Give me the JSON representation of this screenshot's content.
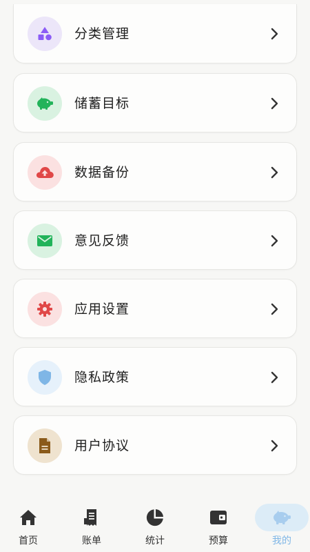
{
  "menu": [
    {
      "label": "分类管理",
      "icon": "shapes-icon",
      "bg": "#ece6f9",
      "fg": "#8b5cf6"
    },
    {
      "label": "储蓄目标",
      "icon": "piggy-bank-icon",
      "bg": "#d9f2e1",
      "fg": "#22b35a"
    },
    {
      "label": "数据备份",
      "icon": "cloud-upload-icon",
      "bg": "#fbe1e1",
      "fg": "#e04848"
    },
    {
      "label": "意见反馈",
      "icon": "mail-icon",
      "bg": "#d9f2e1",
      "fg": "#22b35a"
    },
    {
      "label": "应用设置",
      "icon": "gear-icon",
      "bg": "#fbe1e1",
      "fg": "#e04848"
    },
    {
      "label": "隐私政策",
      "icon": "shield-icon",
      "bg": "#e6f1fb",
      "fg": "#7fb6e6"
    },
    {
      "label": "用户协议",
      "icon": "document-icon",
      "bg": "#efe3cf",
      "fg": "#8a5a1a"
    }
  ],
  "tabs": [
    {
      "label": "首页",
      "icon": "home-icon"
    },
    {
      "label": "账单",
      "icon": "receipt-icon"
    },
    {
      "label": "统计",
      "icon": "pie-chart-icon"
    },
    {
      "label": "预算",
      "icon": "wallet-icon"
    },
    {
      "label": "我的",
      "icon": "piggy-bank-icon",
      "active": true
    }
  ],
  "colors": {
    "active_tab": "#7fb6e6",
    "tab_icon": "#333333",
    "chevron": "#333333"
  }
}
